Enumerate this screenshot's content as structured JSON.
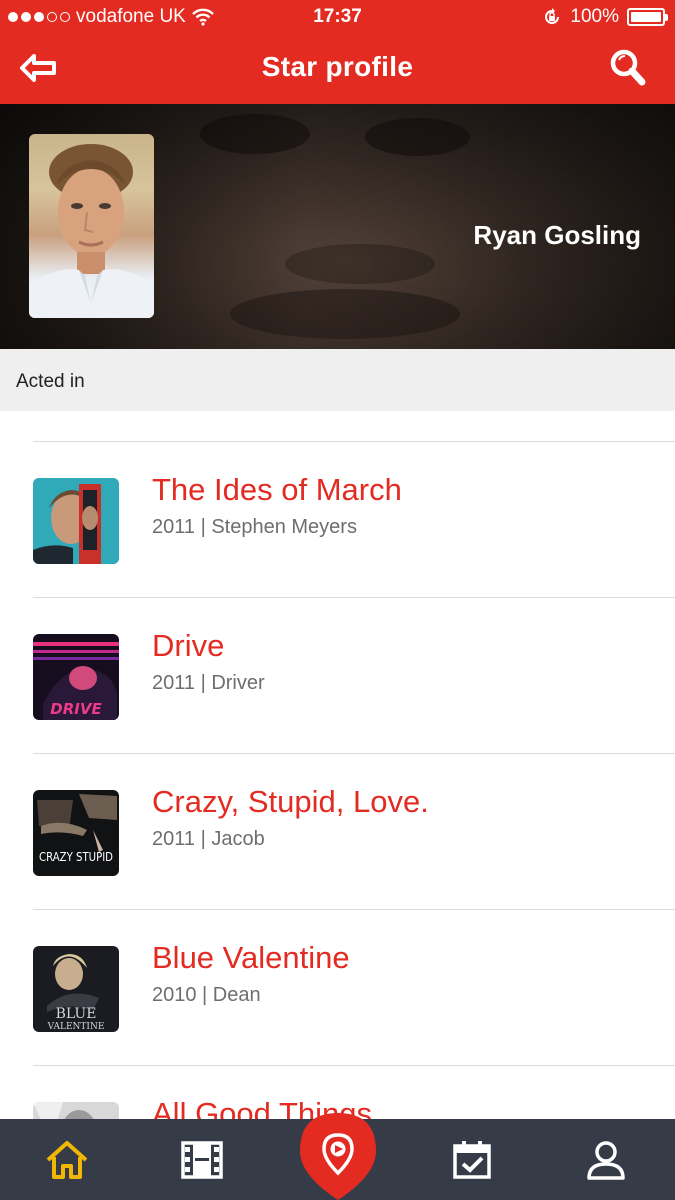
{
  "status_bar": {
    "carrier": "vodafone UK",
    "time": "17:37",
    "battery": "100%"
  },
  "header": {
    "title": "Star profile",
    "back_icon": "back-arrow-icon",
    "search_icon": "search-icon"
  },
  "profile": {
    "name": "Ryan Gosling"
  },
  "section": {
    "title": "Acted in"
  },
  "films": [
    {
      "title": "The Ides of March",
      "meta": "2011 | Stephen Meyers"
    },
    {
      "title": "Drive",
      "meta": "2011 | Driver"
    },
    {
      "title": "Crazy, Stupid, Love.",
      "meta": "2011 | Jacob"
    },
    {
      "title": "Blue Valentine",
      "meta": "2010 | Dean"
    },
    {
      "title": "All Good Things",
      "meta": ""
    }
  ],
  "posters": {
    "crazy": "CRAZY STUPID",
    "blue_valentine_line1": "BLUE",
    "blue_valentine_line2": "VALENTINE",
    "drive": "DRIVE"
  },
  "tabbar": {
    "items": [
      "home-icon",
      "film-icon",
      "location-pin-icon",
      "calendar-check-icon",
      "user-icon"
    ],
    "active_color": "#f2b705",
    "accent": "#e32b22"
  }
}
